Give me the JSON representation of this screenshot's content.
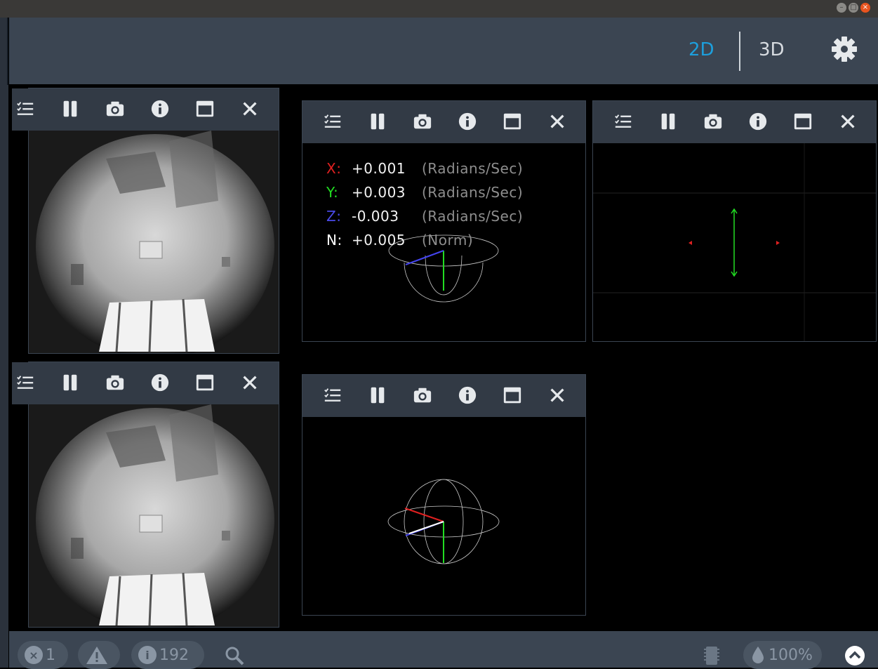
{
  "window": {
    "controls": [
      "minimize",
      "maximize",
      "close"
    ]
  },
  "header": {
    "view_2d": "2D",
    "view_3d": "3D",
    "active_view": "2D",
    "settings_icon": "gear-icon"
  },
  "toolbar_icons": [
    "checklist-icon",
    "pause-icon",
    "camera-icon",
    "info-icon",
    "window-icon",
    "close-icon"
  ],
  "imu": {
    "rows": [
      {
        "label": "X:",
        "value": "+0.001",
        "unit": "(Radians/Sec)",
        "color": "#e02020"
      },
      {
        "label": "Y:",
        "value": "+0.003",
        "unit": "(Radians/Sec)",
        "color": "#22dd22"
      },
      {
        "label": "Z:",
        "value": "-0.003",
        "unit": "(Radians/Sec)",
        "color": "#4a4ae8"
      },
      {
        "label": "N:",
        "value": "+0.005",
        "unit": "(Norm)",
        "color": "#ffffff"
      }
    ]
  },
  "statusbar": {
    "errors": "1",
    "warnings": "",
    "info": "192",
    "search_icon": "search-icon",
    "chip_icon": "chip-icon",
    "zoom": "100%",
    "expand_icon": "chevron-up-icon"
  },
  "colors": {
    "accent": "#1d9fdc",
    "topbar": "#3b4552",
    "toolbar": "#323a45"
  }
}
